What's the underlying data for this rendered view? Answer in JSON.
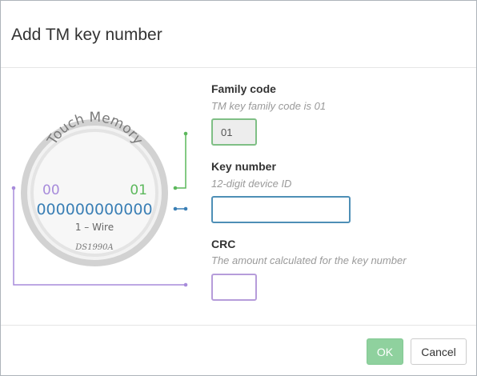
{
  "dialog": {
    "title": "Add TM key number"
  },
  "badge": {
    "arc_text": "Touch Memory",
    "left_code": "00",
    "right_code": "01",
    "key_digits": "000000000000",
    "protocol": "1 – Wire",
    "model": "DS1990A",
    "colors": {
      "family": "#5cb85c",
      "key": "#3a7fb5",
      "crc": "#a78bdb"
    }
  },
  "fields": {
    "family": {
      "label": "Family code",
      "help": "TM key family code is 01",
      "value": "01"
    },
    "key": {
      "label": "Key number",
      "help": "12-digit device ID",
      "value": ""
    },
    "crc": {
      "label": "CRC",
      "help": "The amount calculated for the key number",
      "value": ""
    }
  },
  "buttons": {
    "ok": "OK",
    "cancel": "Cancel"
  }
}
